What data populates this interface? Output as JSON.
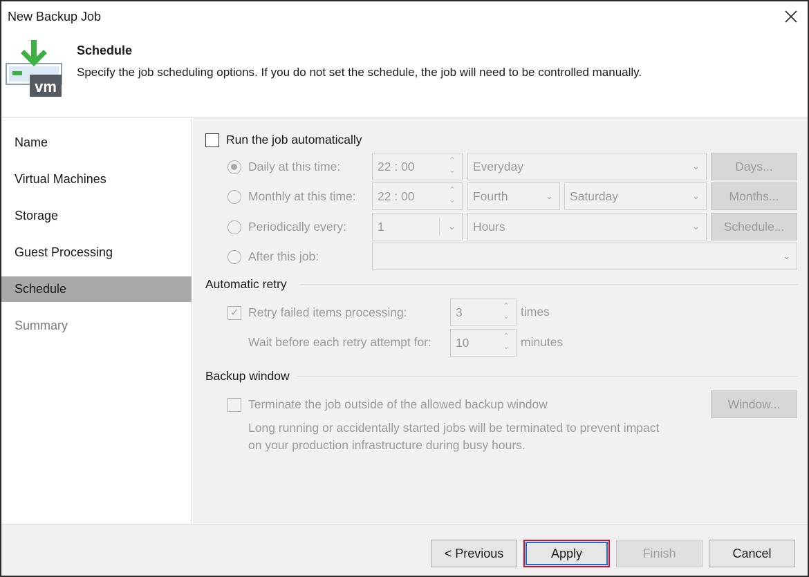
{
  "window": {
    "title": "New Backup Job"
  },
  "header": {
    "title": "Schedule",
    "description": "Specify the job scheduling options. If you do not set the schedule, the job will need to be controlled manually.",
    "icon_name": "vm-backup-icon",
    "icon_text": "vm"
  },
  "sidebar": {
    "items": [
      {
        "label": "Name",
        "state": "normal"
      },
      {
        "label": "Virtual Machines",
        "state": "normal"
      },
      {
        "label": "Storage",
        "state": "normal"
      },
      {
        "label": "Guest Processing",
        "state": "normal"
      },
      {
        "label": "Schedule",
        "state": "active"
      },
      {
        "label": "Summary",
        "state": "disabled"
      }
    ]
  },
  "schedule": {
    "run_auto": {
      "label": "Run the job automatically",
      "checked": false
    },
    "daily": {
      "label": "Daily at this time:",
      "time": "22 : 00",
      "period": "Everyday",
      "button": "Days...",
      "selected": true
    },
    "monthly": {
      "label": "Monthly at this time:",
      "time": "22 : 00",
      "week": "Fourth",
      "day": "Saturday",
      "button": "Months...",
      "selected": false
    },
    "periodically": {
      "label": "Periodically every:",
      "value": "1",
      "unit": "Hours",
      "button": "Schedule...",
      "selected": false
    },
    "after_job": {
      "label": "After this job:",
      "value": "",
      "selected": false
    }
  },
  "retry": {
    "group_title": "Automatic retry",
    "retry_label": "Retry failed items processing:",
    "retry_checked": true,
    "retry_count": "3",
    "retry_unit": "times",
    "wait_label": "Wait before each retry attempt for:",
    "wait_value": "10",
    "wait_unit": "minutes"
  },
  "backup_window": {
    "group_title": "Backup window",
    "terminate_label": "Terminate the job outside of the allowed backup window",
    "terminate_checked": false,
    "button": "Window...",
    "note_line1": "Long running or accidentally started jobs will be terminated to prevent impact",
    "note_line2": "on your production infrastructure during busy hours."
  },
  "footer": {
    "previous": "< Previous",
    "apply": "Apply",
    "finish": "Finish",
    "cancel": "Cancel"
  },
  "colors": {
    "accent_green": "#3cb043",
    "highlight_red": "#d0102e",
    "focus_blue": "#1a6ed8",
    "active_sidebar": "#a8a8a8"
  }
}
